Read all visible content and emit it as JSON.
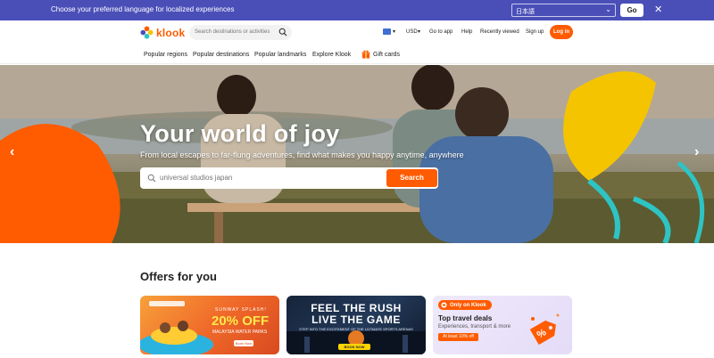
{
  "language_banner": {
    "message": "Choose your preferred language for localized experiences",
    "selected_language": "日本語",
    "go_label": "Go",
    "close_icon": "close-icon"
  },
  "header": {
    "logo_text": "klook",
    "search_placeholder": "Search destinations or activities",
    "currency": "USD",
    "items": [
      "Go to app",
      "Help",
      "Recently viewed",
      "Sign up"
    ],
    "login_label": "Log in"
  },
  "subnav": {
    "items": [
      "Popular regions",
      "Popular destinations",
      "Popular landmarks",
      "Explore Klook"
    ],
    "gift_cards": "Gift cards"
  },
  "hero": {
    "title": "Your world of joy",
    "subtitle": "From local escapes to far-flung adventures, find what makes you happy anytime, anywhere",
    "search_value": "universal studios japan",
    "search_button": "Search"
  },
  "offers": {
    "title": "Offers for you",
    "card1": {
      "eyebrow": "SUNWAY SPLASH!",
      "headline": "20% OFF",
      "subline": "MALAYSIA WATER PARKS",
      "button": "Book Now"
    },
    "card2": {
      "line1": "FEEL THE RUSH",
      "line2": "LIVE THE GAME",
      "subline": "STEP INTO THE EXCITEMENT OF THE ULTIMATE SPORTS ARENAS",
      "button": "BOOK NOW"
    },
    "card3": {
      "badge": "Only on Klook",
      "title": "Top travel deals",
      "subtitle": "Experiences, transport & more",
      "pill": "At least 10% off"
    }
  },
  "colors": {
    "brand": "#ff5b00",
    "banner": "#4a4fb8",
    "accent_yellow": "#f5c400",
    "accent_teal": "#2ec4c4"
  }
}
